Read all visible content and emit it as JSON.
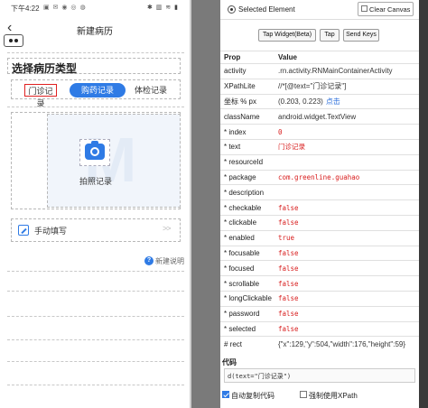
{
  "phone": {
    "status_time": "下午4:22",
    "status_icons": "▣ ✉ ◉ ◎ ◍",
    "status_system": "✱ ▥ ≋ ▮",
    "nav_title": "新建病历",
    "page_heading": "选择病历类型",
    "record_types": [
      "门诊记录",
      "购药记录",
      "体检记录"
    ],
    "photo_label": "拍照记录",
    "photo_watermark": "M",
    "manual_label": "手动填写",
    "manual_arrow": ">>",
    "help_icon": "?",
    "help_text": "新建说明",
    "back_glyph": "‹",
    "accent_color": "#2f7be5",
    "highlight_color": "#e02020"
  },
  "inspector": {
    "selected_label": "Selected Element",
    "clear_label": "Clear Canvas",
    "buttons": {
      "tap_widget": "Tap Widget(Beta)",
      "tap": "Tap",
      "send_keys": "Send Keys"
    },
    "table_headers": [
      "Prop",
      "Value"
    ],
    "rows": [
      {
        "prop": "activity",
        "value": ".rn.activity.RNMainContainerActivity",
        "style": "plain"
      },
      {
        "prop": "XPathLite",
        "value": "//*[@text=\"门诊记录\"]",
        "style": "plain"
      },
      {
        "prop": "坐标 % px",
        "value": "(0.203, 0.223)",
        "link": "点击",
        "style": "plain"
      },
      {
        "prop": "className",
        "value": "android.widget.TextView",
        "style": "plain"
      },
      {
        "prop": "* index",
        "value": "0",
        "style": "red"
      },
      {
        "prop": "* text",
        "value": "门诊记录",
        "style": "red"
      },
      {
        "prop": "* resourceId",
        "value": "",
        "style": "red"
      },
      {
        "prop": "* package",
        "value": "com.greenline.guahao",
        "style": "red"
      },
      {
        "prop": "* description",
        "value": "",
        "style": "red"
      },
      {
        "prop": "* checkable",
        "value": "false",
        "style": "red"
      },
      {
        "prop": "* clickable",
        "value": "false",
        "style": "red"
      },
      {
        "prop": "* enabled",
        "value": "true",
        "style": "red"
      },
      {
        "prop": "* focusable",
        "value": "false",
        "style": "red"
      },
      {
        "prop": "* focused",
        "value": "false",
        "style": "red"
      },
      {
        "prop": "* scrollable",
        "value": "false",
        "style": "red"
      },
      {
        "prop": "* longClickable",
        "value": "false",
        "style": "red"
      },
      {
        "prop": "* password",
        "value": "false",
        "style": "red"
      },
      {
        "prop": "* selected",
        "value": "false",
        "style": "red"
      },
      {
        "prop": "# rect",
        "value": "{\"x\":129,\"y\":504,\"width\":176,\"height\":59}",
        "style": "plain"
      }
    ],
    "code_heading": "代码",
    "code_text": "d(text=\"门诊记录\")",
    "option_auto_copy": "自动复制代码",
    "option_auto_copy_checked": true,
    "option_force_xpath": "强制使用XPath",
    "option_force_xpath_checked": false
  }
}
